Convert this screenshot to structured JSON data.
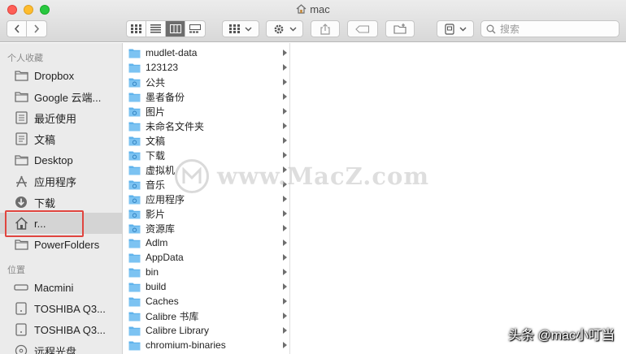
{
  "window": {
    "title": "mac"
  },
  "toolbar": {
    "search_placeholder": "搜索",
    "view_modes": [
      "icon-view",
      "list-view",
      "column-view",
      "gallery-view"
    ],
    "active_view": "column-view"
  },
  "sidebar": {
    "favorites_header": "个人收藏",
    "favorites": [
      {
        "label": "Dropbox",
        "icon": "folder-icon"
      },
      {
        "label": "Google 云端...",
        "icon": "folder-icon"
      },
      {
        "label": "最近使用",
        "icon": "recents-icon"
      },
      {
        "label": "文稿",
        "icon": "documents-icon"
      },
      {
        "label": "Desktop",
        "icon": "folder-icon"
      },
      {
        "label": "应用程序",
        "icon": "applications-icon"
      },
      {
        "label": "下载",
        "icon": "downloads-icon"
      },
      {
        "label": "r...",
        "icon": "home-icon",
        "selected": true
      },
      {
        "label": "PowerFolders",
        "icon": "folder-icon"
      }
    ],
    "locations_header": "位置",
    "locations": [
      {
        "label": "Macmini",
        "icon": "computer-icon"
      },
      {
        "label": "TOSHIBA Q3...",
        "icon": "disk-icon"
      },
      {
        "label": "TOSHIBA Q3...",
        "icon": "disk-icon"
      },
      {
        "label": "远程光盘",
        "icon": "optical-disc-icon"
      }
    ]
  },
  "column": {
    "items": [
      {
        "name": "mudlet-data",
        "icon": "folder-icon"
      },
      {
        "name": "123123",
        "icon": "folder-icon"
      },
      {
        "name": "公共",
        "icon": "public-folder-icon"
      },
      {
        "name": "墨者备份",
        "icon": "folder-icon"
      },
      {
        "name": "图片",
        "icon": "pictures-folder-icon"
      },
      {
        "name": "未命名文件夹",
        "icon": "folder-icon"
      },
      {
        "name": "文稿",
        "icon": "documents-folder-icon"
      },
      {
        "name": "下载",
        "icon": "downloads-folder-icon"
      },
      {
        "name": "虚拟机",
        "icon": "folder-icon"
      },
      {
        "name": "音乐",
        "icon": "music-folder-icon"
      },
      {
        "name": "应用程序",
        "icon": "applications-folder-icon"
      },
      {
        "name": "影片",
        "icon": "movies-folder-icon"
      },
      {
        "name": "资源库",
        "icon": "library-folder-icon"
      },
      {
        "name": "Adlm",
        "icon": "folder-icon"
      },
      {
        "name": "AppData",
        "icon": "folder-icon"
      },
      {
        "name": "bin",
        "icon": "folder-icon"
      },
      {
        "name": "build",
        "icon": "folder-icon"
      },
      {
        "name": "Caches",
        "icon": "folder-icon"
      },
      {
        "name": "Calibre 书库",
        "icon": "folder-icon"
      },
      {
        "name": "Calibre Library",
        "icon": "folder-icon"
      },
      {
        "name": "chromium-binaries",
        "icon": "folder-icon"
      }
    ]
  },
  "watermark": {
    "text": "www.MacZ.com"
  },
  "caption": {
    "text": "头条 @mac小叮当"
  },
  "colors": {
    "folder": "#5fb3ec",
    "highlight": "#e0453f",
    "sidebar_bg": "#ebebeb"
  }
}
